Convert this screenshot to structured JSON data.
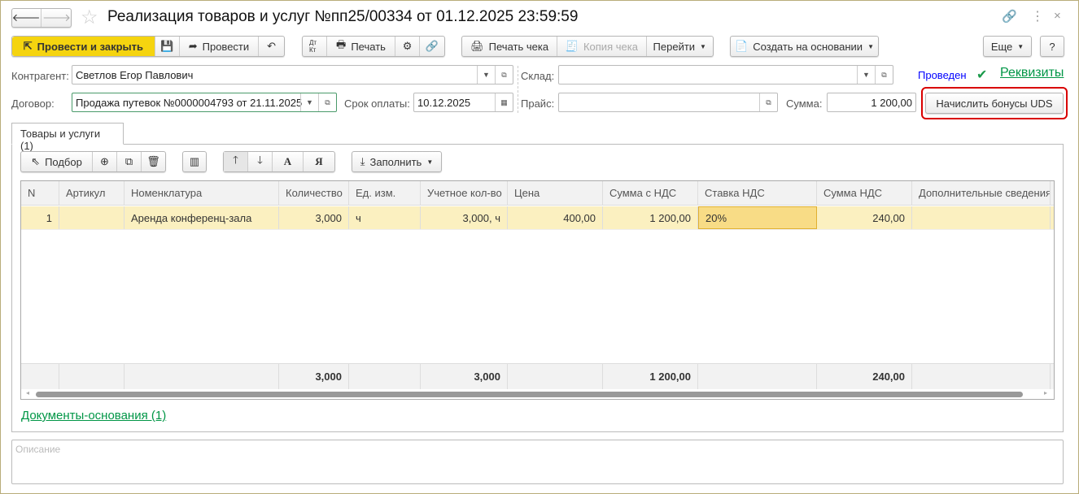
{
  "window": {
    "title": "Реализация товаров и услуг №пп25/00334 от 01.12.2025 23:59:59"
  },
  "toolbar": {
    "post_close": "Провести и закрыть",
    "post": "Провести",
    "dtkt": "Дт Кт",
    "print": "Печать",
    "print_receipt": "Печать чека",
    "copy_receipt": "Копия чека",
    "goto": "Перейти",
    "create_based": "Создать на основании",
    "more": "Еще",
    "help": "?"
  },
  "form": {
    "counterparty_label": "Контрагент:",
    "counterparty": "Светлов Егор Павлович",
    "contract_label": "Договор:",
    "contract": "Продажа путевок №0000004793 от 21.11.2025",
    "due_label": "Срок оплаты:",
    "due": "10.12.2025",
    "warehouse_label": "Склад:",
    "warehouse": "",
    "price_label": "Прайс:",
    "price": "",
    "sum_label": "Сумма:",
    "sum": "1 200,00",
    "status": "Проведен",
    "requisites": "Реквизиты",
    "bonus_button": "Начислить бонусы UDS"
  },
  "tab": {
    "label": "Товары и услуги (1)"
  },
  "table_toolbar": {
    "pick": "Подбор",
    "fill": "Заполнить",
    "sort_a": "А",
    "sort_z": "Я"
  },
  "table": {
    "columns": [
      "N",
      "Артикул",
      "Номенклатура",
      "Количество",
      "Ед. изм.",
      "Учетное кол-во",
      "Цена",
      "Сумма с НДС",
      "Ставка НДС",
      "Сумма НДС",
      "Дополнительные сведения"
    ],
    "rows": [
      [
        "1",
        "",
        "Аренда конференц-зала",
        "3,000",
        "ч",
        "3,000, ч",
        "400,00",
        "1 200,00",
        "20%",
        "240,00",
        ""
      ]
    ],
    "totals": [
      "",
      "",
      "",
      "3,000",
      "",
      "3,000",
      "",
      "1 200,00",
      "",
      "240,00",
      ""
    ]
  },
  "base_docs": "Документы-основания (1)",
  "description_placeholder": "Описание",
  "colors": {
    "accent": "#f5d40f",
    "link": "#009646",
    "status": "#0000ff",
    "highlight": "#d90000",
    "row": "#fbf0c0"
  }
}
